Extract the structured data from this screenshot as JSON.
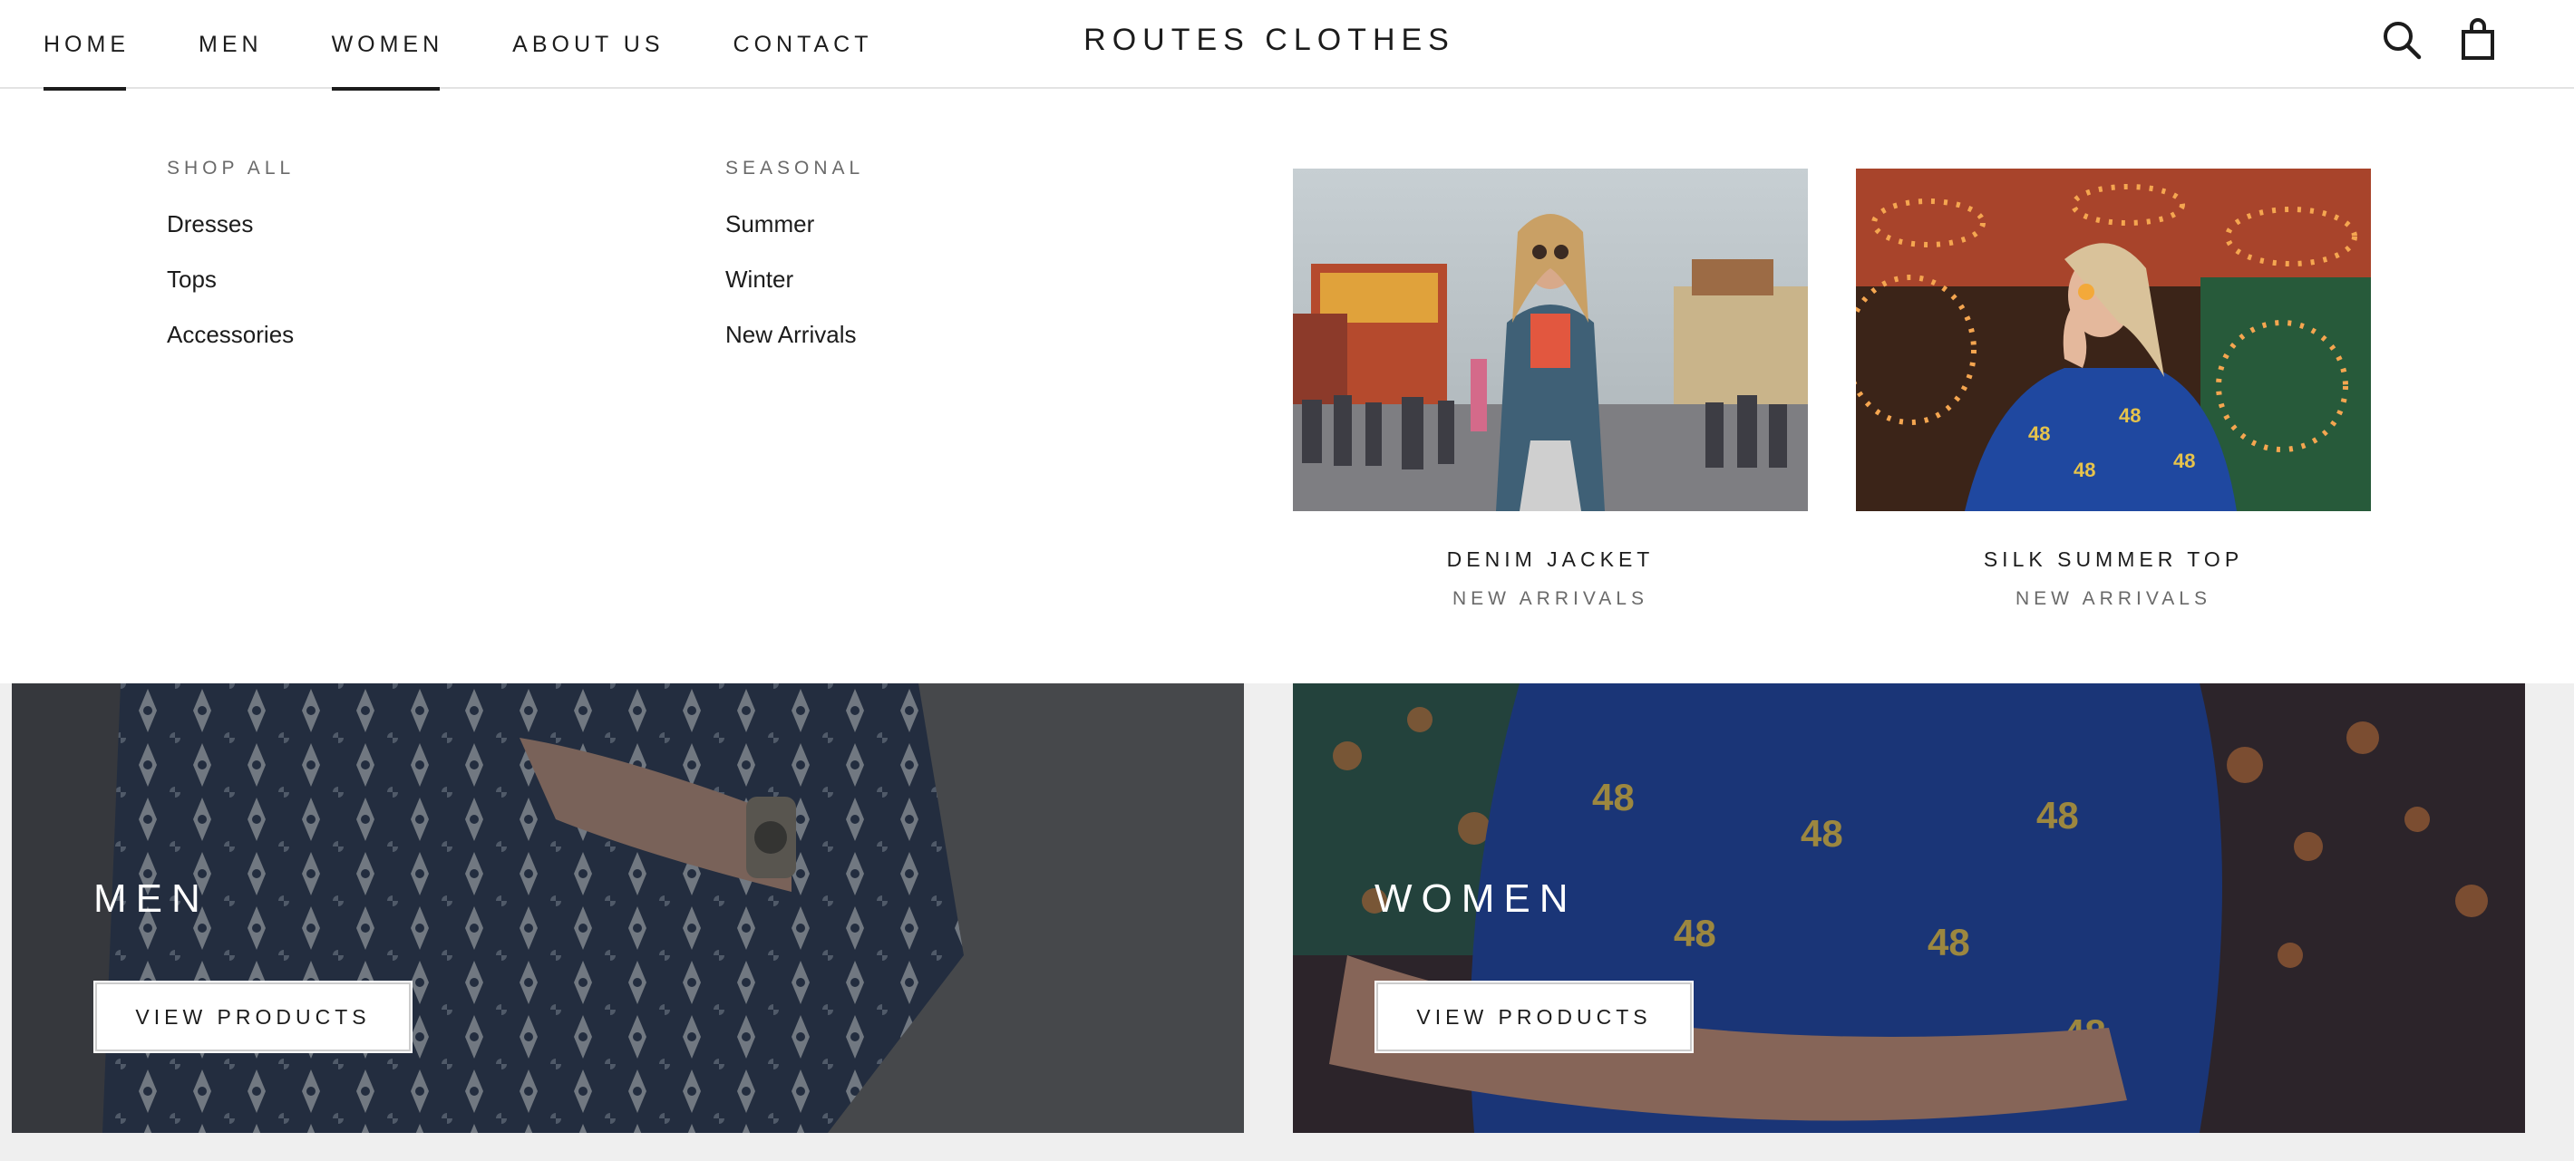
{
  "header": {
    "nav": [
      {
        "label": "HOME",
        "underlined": true
      },
      {
        "label": "MEN",
        "underlined": false
      },
      {
        "label": "WOMEN",
        "underlined": true
      },
      {
        "label": "ABOUT US",
        "underlined": false
      },
      {
        "label": "CONTACT",
        "underlined": false
      }
    ],
    "logo": "ROUTES CLOTHES",
    "icons": [
      "search-icon",
      "shopping-bag-icon"
    ]
  },
  "mega_menu": {
    "columns": [
      {
        "heading": "SHOP ALL",
        "links": [
          "Dresses",
          "Tops",
          "Accessories"
        ]
      },
      {
        "heading": "SEASONAL",
        "links": [
          "Summer",
          "Winter",
          "New Arrivals"
        ]
      }
    ],
    "promos": [
      {
        "title": "DENIM JACKET",
        "subtitle": "NEW ARRIVALS",
        "image": "woman-denim-jacket-at-fair-photo"
      },
      {
        "title": "SILK SUMMER TOP",
        "subtitle": "NEW ARRIVALS",
        "image": "woman-blue-silk-top-carnival-lights-photo"
      }
    ]
  },
  "collections": [
    {
      "title": "MEN",
      "button": "VIEW PRODUCTS",
      "image": "man-patterned-shirt-wristwatch-photo"
    },
    {
      "title": "WOMEN",
      "button": "VIEW PRODUCTS",
      "image": "woman-blue-printed-shirt-bokeh-photo"
    }
  ],
  "colors": {
    "text": "#1c1c1c",
    "muted": "#6a6a6a",
    "page_background": "#efefef",
    "header_background": "#ffffff"
  }
}
